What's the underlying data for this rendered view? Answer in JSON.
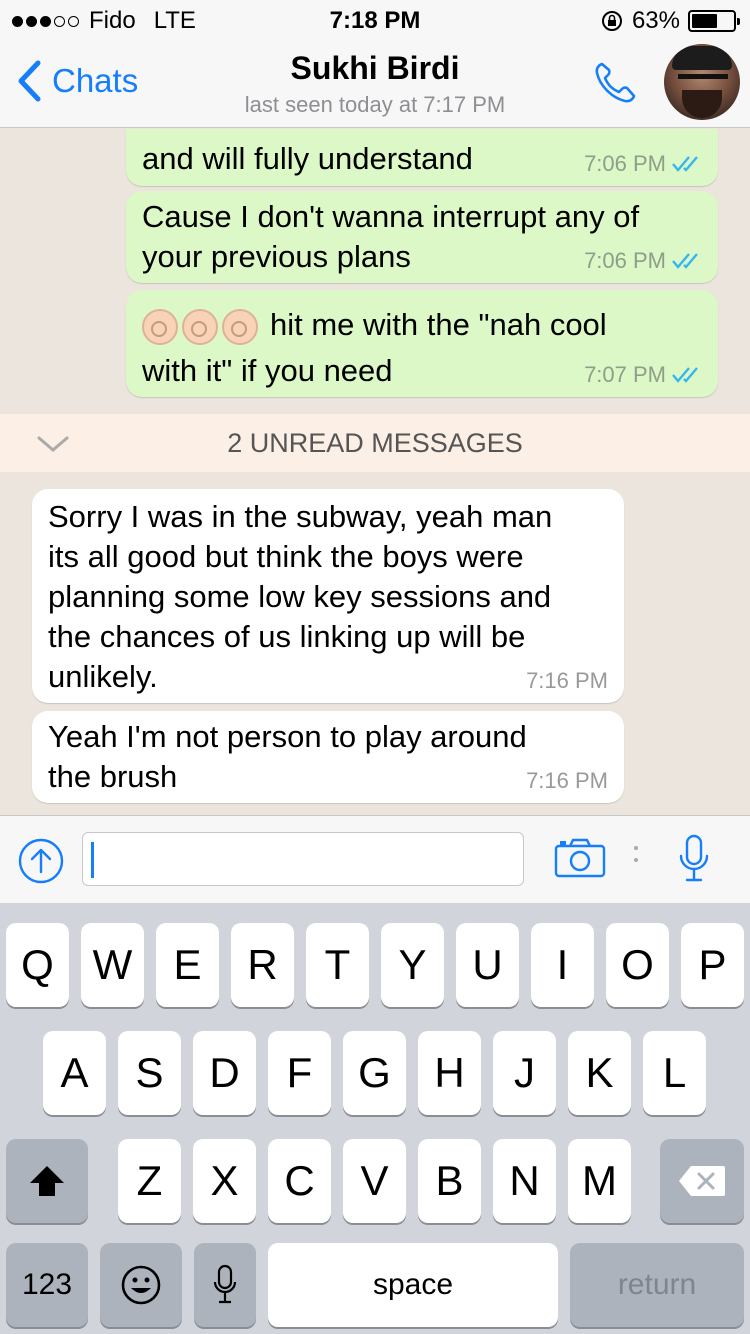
{
  "status_bar": {
    "carrier": "Fido",
    "network": "LTE",
    "time": "7:18 PM",
    "battery": "63%",
    "battery_level": 0.63
  },
  "nav": {
    "back_label": "Chats",
    "contact_name": "Sukhi Birdi",
    "last_seen": "last seen today at 7:17 PM",
    "accent_color": "#157efb"
  },
  "messages": [
    {
      "direction": "out",
      "text": "and will fully understand",
      "time": "7:06 PM",
      "read": true
    },
    {
      "direction": "out",
      "text": "Cause I don't wanna interrupt any of\nyour previous plans",
      "time": "7:06 PM",
      "read": true
    },
    {
      "direction": "out",
      "emoji": [
        "ok-hand",
        "ok-hand",
        "ok-hand"
      ],
      "text": "hit me with the \"nah cool\nwith it\" if you need",
      "time": "7:07 PM",
      "read": true
    },
    {
      "direction": "in",
      "text": "Sorry I was in the subway, yeah man\nits all good but think the boys were\nplanning some low key sessions and\nthe chances of us linking up will be\nunlikely.",
      "time": "7:16 PM"
    },
    {
      "direction": "in",
      "text": "Yeah I'm not person to play around\nthe brush",
      "time": "7:16 PM"
    }
  ],
  "unread_banner": "2 UNREAD MESSAGES",
  "input": {
    "value": "",
    "placeholder": ""
  },
  "keyboard": {
    "row1": [
      "Q",
      "W",
      "E",
      "R",
      "T",
      "Y",
      "U",
      "I",
      "O",
      "P"
    ],
    "row2": [
      "A",
      "S",
      "D",
      "F",
      "G",
      "H",
      "J",
      "K",
      "L"
    ],
    "row3": [
      "Z",
      "X",
      "C",
      "V",
      "B",
      "N",
      "M"
    ],
    "numbers_label": "123",
    "space_label": "space",
    "return_label": "return"
  }
}
